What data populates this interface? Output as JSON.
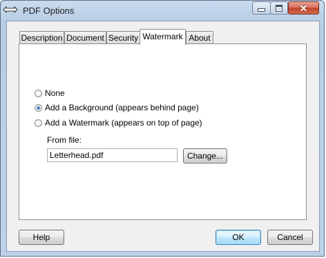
{
  "window": {
    "title": "PDF Options",
    "icons": {
      "app": "printer-icon",
      "minimize": "minimize-icon",
      "maximize": "maximize-icon",
      "close": "close-icon"
    }
  },
  "tabs": [
    {
      "label": "Description",
      "selected": false
    },
    {
      "label": "Document",
      "selected": false
    },
    {
      "label": "Security",
      "selected": false
    },
    {
      "label": "Watermark",
      "selected": true
    },
    {
      "label": "About",
      "selected": false
    }
  ],
  "watermark": {
    "options": [
      {
        "label": "None",
        "checked": false
      },
      {
        "label": "Add a Background (appears behind page)",
        "checked": true
      },
      {
        "label": "Add a Watermark (appears on top of page)",
        "checked": false
      }
    ],
    "from_file_label": "From file:",
    "file_value": "Letterhead.pdf",
    "change_label": "Change..."
  },
  "footer": {
    "help_label": "Help",
    "ok_label": "OK",
    "cancel_label": "Cancel"
  },
  "colors": {
    "frame": "#bed1e8",
    "close_button": "#c0432c",
    "default_button_border": "#3c7fb1"
  }
}
